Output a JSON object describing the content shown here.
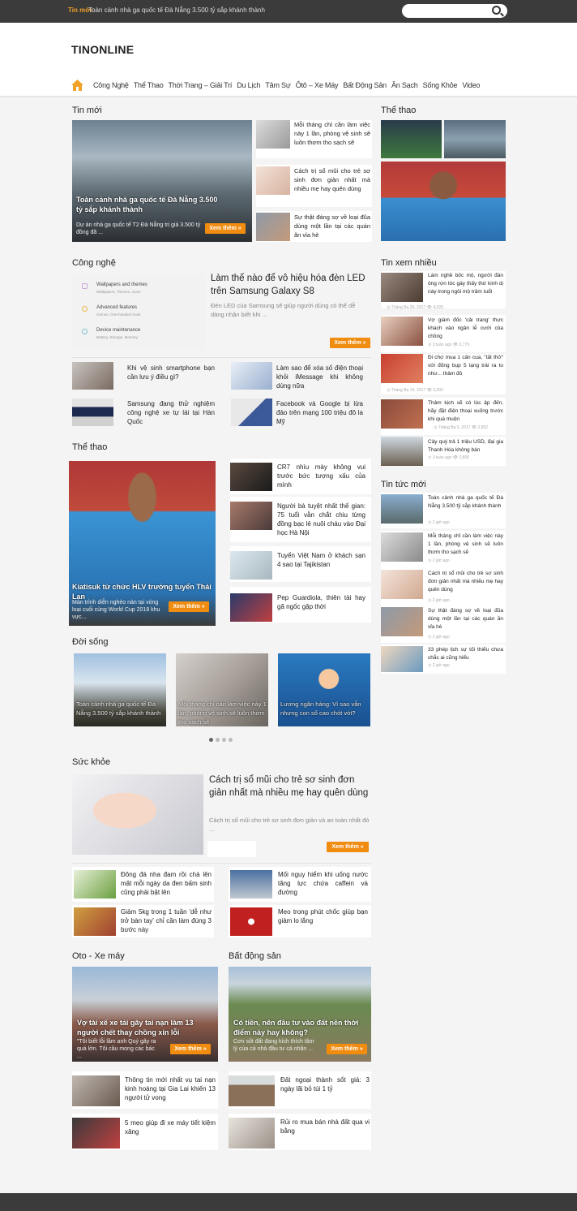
{
  "topbar": {
    "label": "Tin mới:",
    "ticker": "Toàn cảnh nhà ga quốc tế Đà Nẵng 3.500 tỷ sắp khánh thành",
    "search_placeholder": ""
  },
  "logo": "TINONLINE",
  "nav": [
    "Công Nghệ",
    "Thể Thao",
    "Thời Trang – Giải Trí",
    "Du Lịch",
    "Tâm Sự",
    "Ôtô – Xe Máy",
    "Bất Động Sản",
    "Ăn Sạch",
    "Sống Khỏe",
    "Video"
  ],
  "more_label": "Xem thêm »",
  "tinmoi": {
    "title": "Tin mới",
    "main": {
      "title": "Toàn cảnh nhà ga quốc tế Đà Nẵng 3.500 tỷ sắp khánh thành",
      "desc": "Dự án nhà ga quốc tế T2 Đà Nẵng trị giá 3.500 tỷ đồng đã ..."
    },
    "side": [
      "Mỗi tháng chỉ cần làm việc này 1 lần, phòng vệ sinh sẽ luôn thơm tho sạch sẽ",
      "Cách trị sổ mũi cho trẻ sơ sinh đơn giản nhất mà nhiều mẹ hay quên dùng",
      "Sự thật đáng sợ về loại đũa dùng một lần tại các quán ăn vỉa hè"
    ]
  },
  "thethao_side": {
    "title": "Thể thao"
  },
  "congnghe": {
    "title": "Công nghệ",
    "settings": [
      {
        "h": "Wallpapers and themes",
        "s": "Wallpapers, Themes, Icons"
      },
      {
        "h": "Advanced features",
        "s": "Games, One-handed mode"
      },
      {
        "h": "Device maintenance",
        "s": "Battery, Storage, Memory"
      }
    ],
    "main_title": "Làm thế nào để vô hiệu hóa đèn LED trên Samsung Galaxy S8",
    "main_desc": "Đèn LED của Samsung sẽ giúp người dùng có thể dễ dàng nhận biết khi ...",
    "items": [
      "Khi vệ sinh smartphone bạn cần lưu ý điều gì?",
      "Làm sao để xóa số điện thoại khỏi iMessage khi không dùng nữa",
      "Samsung đang thử nghiệm công nghệ xe tự lái tại Hàn Quốc",
      "Facebook và Google bị lừa đảo trên mạng 100 triệu đô la Mỹ"
    ]
  },
  "tinxemnhieu": {
    "title": "Tin xem nhiều",
    "items": [
      {
        "t": "Làm nghề bốc mộ, người đàn ông rợn tóc gáy thấy thứ kinh dị này trong ngôi mộ trăm tuổi",
        "m": "◷ Tháng Ba 20, 2017  👁 4,020"
      },
      {
        "t": "Vợ giám đốc 'cải trang' thực khách vào ngân lễ cưới của chồng",
        "m": "◷ 3 tuần ago  👁 3,779"
      },
      {
        "t": "Đi chợ mua 1 cân cua, \"tất thở\" với đống bụp 5 lạng trái ra to như... thảm đỏ",
        "m": "◷ Tháng Ba 14, 2017  👁 3,093"
      },
      {
        "t": "Thảm kịch sẽ có lúc ập đến, hãy đặt điện thoại xuống trước khi quá muộn",
        "m": "◷ Tháng Ba 5, 2017  👁 2,852"
      },
      {
        "t": "Cây quý trả 1 triệu USD, đại gia Thanh Hóa không bán",
        "m": "◷ 3 tuần ago  👁 2,805"
      }
    ]
  },
  "thethao": {
    "title": "Thể thao",
    "main": {
      "title": "Kiatisuk từ chức HLV trưởng tuyển Thái Lan",
      "desc": "Màn trình diễn nghèo nàn tại vòng loại cuối cùng World Cup 2018 khu vực..."
    },
    "items": [
      "CR7 nhìu mày không vui trước bức tượng xấu của mình",
      "Người bà tuyệt nhất thế gian: 75 tuổi vẫn chắt chiu từng đồng bạc lẻ nuôi cháu vào Đại học Hà Nội",
      "Tuyển Việt Nam ở khách sạn 4 sao tại Tajikistan",
      "Pep Guardiola, thiên tài hay gã ngốc gặp thời"
    ]
  },
  "tintucmoi": {
    "title": "Tin tức mới",
    "time": "◷ 2 giờ ago",
    "items": [
      "Toàn cảnh nhà ga quốc tế Đà Nẵng 3.500 tỷ sắp khánh thành",
      "Mỗi tháng chỉ cần làm việc này 1 lần, phòng vệ sinh sẽ luôn thơm tho sạch sẽ",
      "Cách trị sổ mũi cho trẻ sơ sinh đơn giản nhất mà nhiều mẹ hay quên dùng",
      "Sự thật đáng sợ về loại đũa dùng một lần tại các quán ăn vỉa hè",
      "33 phép lịch sự tối thiểu chưa chắc ai cũng hiểu"
    ]
  },
  "doisong": {
    "title": "Đời sống",
    "items": [
      "Toàn cảnh nhà ga quốc tế Đà Nẵng 3.500 tỷ sắp khánh thành",
      "Mỗi tháng chỉ cần làm việc này 1 lần, phòng vệ sinh sẽ luôn thơm tho sạch sẽ",
      "Lương ngân hàng: Vì sao vẫn nhưng con số cao chót vót?"
    ]
  },
  "suckhoe": {
    "title": "Sức khỏe",
    "main_title": "Cách trị sổ mũi cho trẻ sơ sinh đơn giản nhất mà nhiều mẹ hay quên dùng",
    "main_desc": "Cách trị sổ mũi cho trẻ sơ sinh đơn giản và an toàn nhất đó ...",
    "items": [
      "Đông đá nha đam rồi chà lên mặt mỗi ngày da đen bấm sinh cũng phải bật lên",
      "Mối nguy hiểm khi uống nước tăng lực chứa caffein và đường",
      "Giảm 5kg trong 1 tuần 'dễ như trở bàn tay' chỉ cần làm đúng 3 bước này",
      "Mẹo trong phút chốc giúp bạn giảm lo lắng"
    ]
  },
  "oto": {
    "title": "Oto - Xe máy",
    "main": {
      "title": "Vợ tài xế xe tải gây tai nạn làm 13 người chết thay chồng xin lỗi",
      "desc": "\"Tôi biết lỗi lầm anh Quý gây ra quá lớn. Tôi cầu mong các bác ..."
    },
    "items": [
      "Thông tin mới nhất vụ tai nạn kinh hoàng tại Gia Lai khiến 13 người tử vong",
      "5 mẹo giúp đi xe máy tiết kiệm xăng"
    ]
  },
  "bds": {
    "title": "Bất động sản",
    "main": {
      "title": "Có tiền, nên đầu tư vào đất nền thời điểm này hay không?",
      "desc": "Cơn sốt đất đang kích thích tâm lý của cả nhà đầu tư cá nhân ..."
    },
    "items": [
      "Đất ngoại thành sốt giá: 3 ngày lãi bỏ túi 1 tỷ",
      "Rủi ro mua bán nhà đất qua vi bằng"
    ]
  }
}
